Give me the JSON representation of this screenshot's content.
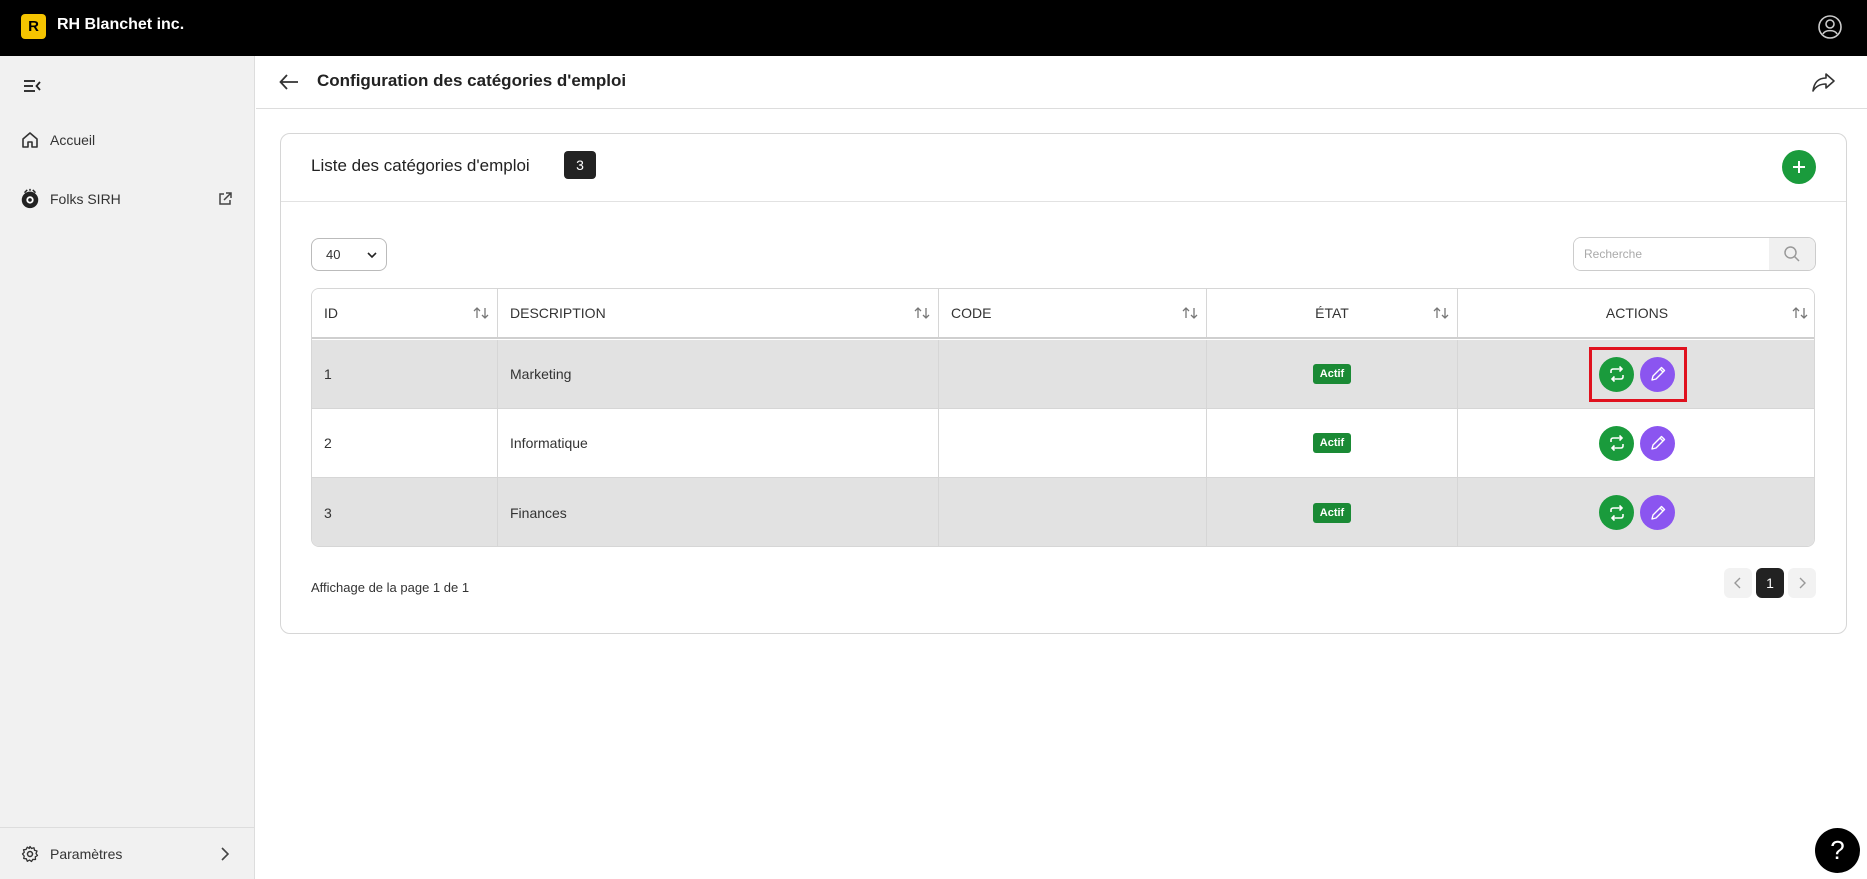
{
  "topbar": {
    "logo_letter": "R",
    "company": "RH Blanchet inc.",
    "user_icon": "user-circle-icon"
  },
  "sidebar": {
    "items": [
      {
        "label": "Accueil",
        "icon": "home-icon"
      },
      {
        "label": "Folks SIRH",
        "icon": "folks-logo-icon",
        "external": "external-link-icon"
      }
    ],
    "bottom": {
      "label": "Paramètres",
      "icon": "gear-icon"
    }
  },
  "header": {
    "title": "Configuration des catégories d'emploi"
  },
  "card": {
    "title": "Liste des catégories d'emploi",
    "count": "3",
    "page_size": "40",
    "search_placeholder": "Recherche"
  },
  "table": {
    "columns": [
      "ID",
      "DESCRIPTION",
      "CODE",
      "ÉTAT",
      "ACTIONS"
    ],
    "rows": [
      {
        "id": "1",
        "description": "Marketing",
        "code": "",
        "status": "Actif"
      },
      {
        "id": "2",
        "description": "Informatique",
        "code": "",
        "status": "Actif"
      },
      {
        "id": "3",
        "description": "Finances",
        "code": "",
        "status": "Actif"
      }
    ]
  },
  "pagination": {
    "info": "Affichage de la page 1 de 1",
    "current": "1"
  },
  "help": {
    "label": "?"
  },
  "colors": {
    "accent_green": "#1a9b3c",
    "edit_purple": "#8b55f0",
    "logo_yellow": "#f5c400",
    "highlight_red": "#e0111e"
  }
}
